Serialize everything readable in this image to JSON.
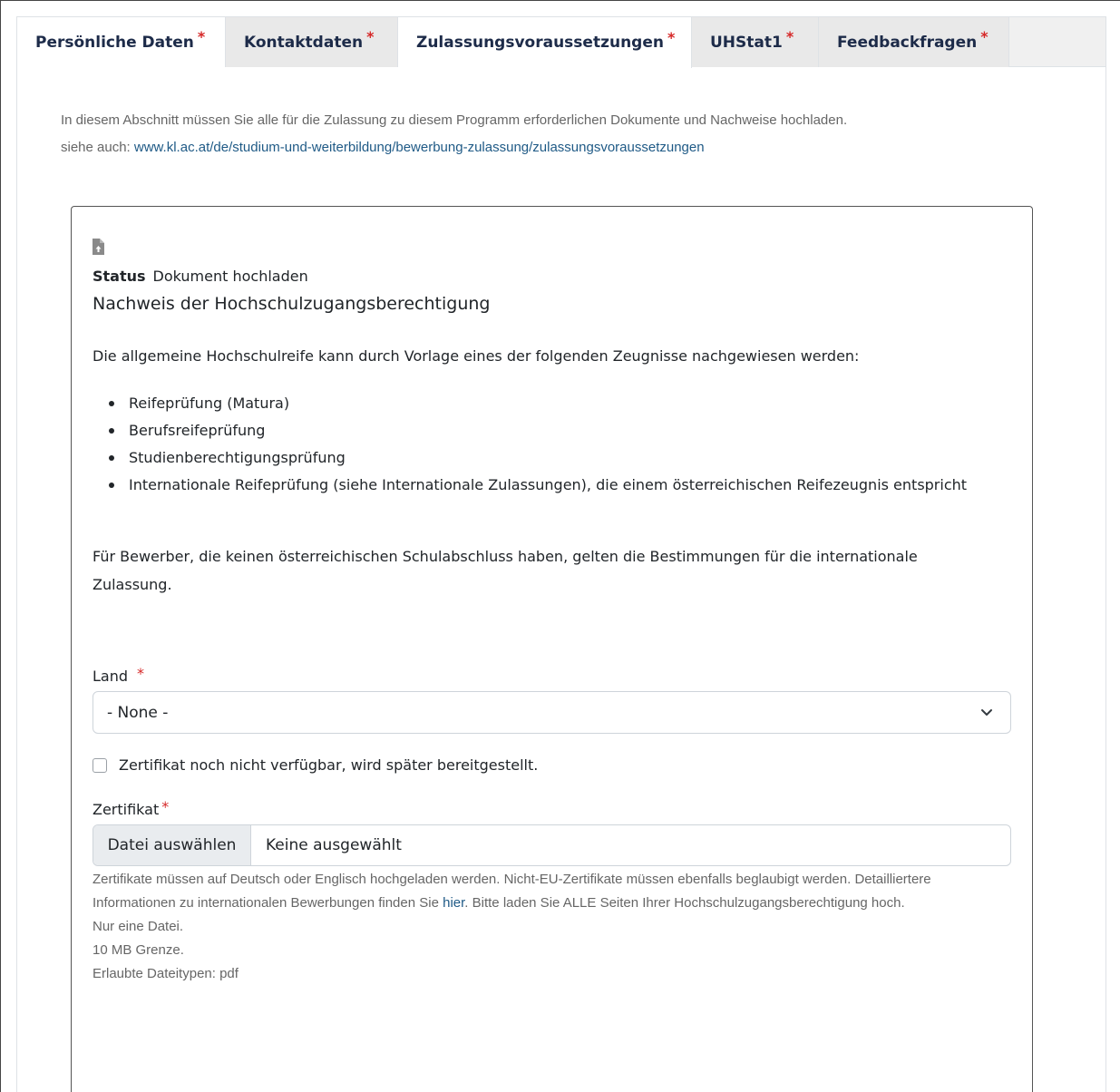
{
  "tabs": [
    {
      "label": "Persönliche Daten",
      "required": "*"
    },
    {
      "label": "Kontaktdaten",
      "required": "*"
    },
    {
      "label": "Zulassungsvoraussetzungen",
      "required": "*",
      "active": true
    },
    {
      "label": "UHStat1",
      "required": "*"
    },
    {
      "label": "Feedbackfragen",
      "required": "*"
    }
  ],
  "intro": {
    "text": "In diesem Abschnitt müssen Sie alle für die Zulassung zu diesem Programm erforderlichen Dokumente und Nachweise hochladen.",
    "see_also_prefix": "siehe auch: ",
    "see_also_link": "www.kl.ac.at/de/studium-und-weiterbildung/bewerbung-zulassung/zulassungsvoraussetzungen"
  },
  "document": {
    "icon": "file-upload-icon",
    "status_label": "Status",
    "status_value": "Dokument hochladen",
    "title": "Nachweis der Hochschulzugangsberechtigung",
    "description": "Die allgemeine Hochschulreife kann durch Vorlage eines der folgenden Zeugnisse nachgewiesen werden:",
    "items": [
      "Reifeprüfung (Matura)",
      "Berufsreifeprüfung",
      "Studienberechtigungsprüfung",
      "Internationale Reifeprüfung (siehe Internationale Zulassungen), die einem österreichischen Reifezeugnis entspricht"
    ],
    "note": "Für Bewerber, die keinen österreichischen Schulabschluss haben, gelten die Bestimmungen für die internationale Zulassung."
  },
  "form": {
    "land_label": "Land",
    "land_required": "*",
    "land_value": "- None -",
    "checkbox_label": "Zertifikat noch nicht verfügbar, wird später bereitgestellt.",
    "zertifikat_label": "Zertifikat",
    "zertifikat_required": "*",
    "file_button": "Datei auswählen",
    "file_status": "Keine ausgewählt",
    "help_1": "Zertifikate müssen auf Deutsch oder Englisch hochgeladen werden. Nicht-EU-Zertifikate müssen ebenfalls beglaubigt werden. Detailliertere Informationen zu internationalen Bewerbungen finden Sie ",
    "help_link": "hier",
    "help_2": ". Bitte laden Sie ALLE Seiten Ihrer Hochschulzugangsberechtigung hoch.",
    "help_single_file": "Nur eine Datei.",
    "help_limit": "10 MB Grenze.",
    "help_types": "Erlaubte Dateitypen: pdf"
  },
  "colors": {
    "required": "#d62828",
    "link": "#1f5a86",
    "tab_text": "#1d2b49"
  }
}
